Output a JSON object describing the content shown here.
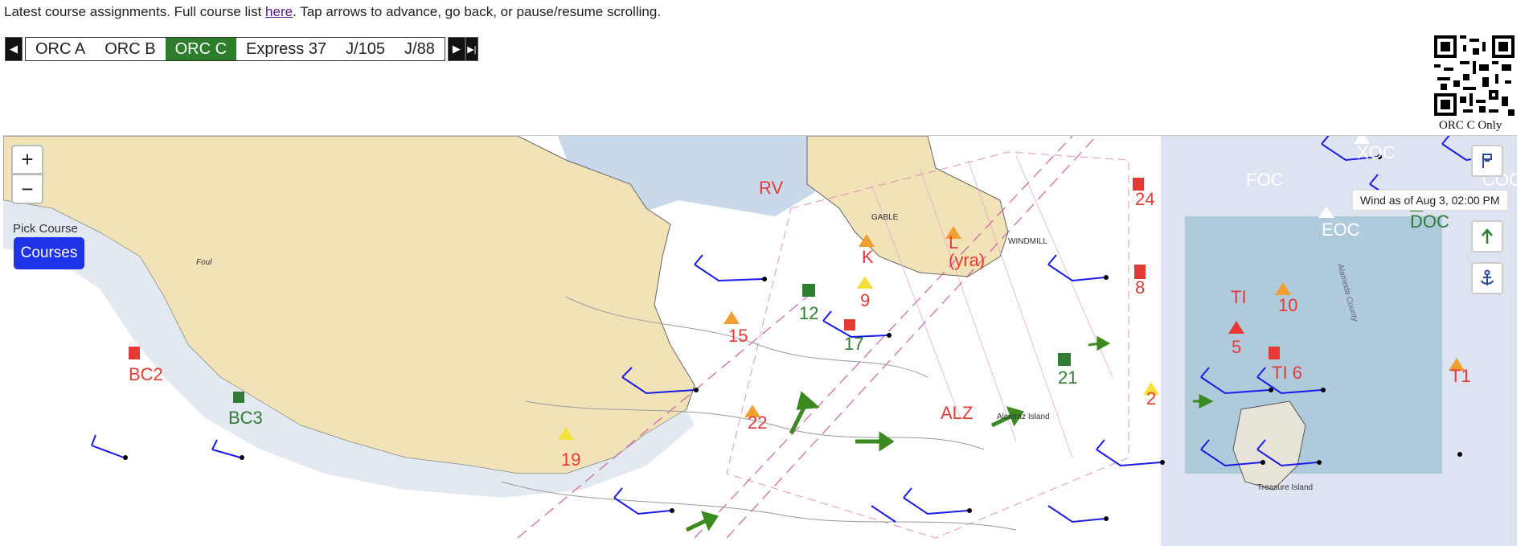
{
  "intro": {
    "prefix": "Latest course assignments. Full course list ",
    "link": "here",
    "suffix": ". Tap arrows to advance, go back, or pause/resume scrolling."
  },
  "classes": {
    "tabs": [
      {
        "label": "ORC A",
        "active": false
      },
      {
        "label": "ORC B",
        "active": false
      },
      {
        "label": "ORC C",
        "active": true
      },
      {
        "label": "Express 37",
        "active": false
      },
      {
        "label": "J/105",
        "active": false
      },
      {
        "label": "J/88",
        "active": false
      }
    ],
    "prev_icon": "triangle-left-icon",
    "next_icon": "triangle-right-icon",
    "pause_icon": "skip-end-icon"
  },
  "qr": {
    "caption": "ORC C Only"
  },
  "map": {
    "pick_label": "Pick Course",
    "courses_label": "Courses",
    "zoom_in": "+",
    "zoom_out": "−",
    "wind_time": "Wind as of Aug 3, 02:00 PM",
    "controls": [
      "flag-icon",
      "north-arrow-icon",
      "anchor-icon"
    ],
    "colors": {
      "land": "#f2e2b8",
      "water": "#ffffff",
      "shallow": "#c9d8ea",
      "overlay": "#a8c6d8",
      "red_mark": "#e53935",
      "green_mark": "#2e7d32",
      "wind": "#1a1ae6",
      "arrow": "#3a8a20"
    },
    "marks": [
      {
        "label": "BC2",
        "color": "red"
      },
      {
        "label": "BC3",
        "color": "green"
      },
      {
        "label": "RV",
        "color": "red"
      },
      {
        "label": "24",
        "color": "red"
      },
      {
        "label": "K",
        "color": "red"
      },
      {
        "label": "L",
        "color": "red"
      },
      {
        "label": "(yra)",
        "color": "red"
      },
      {
        "label": "9",
        "color": "red"
      },
      {
        "label": "12",
        "color": "green"
      },
      {
        "label": "15",
        "color": "red"
      },
      {
        "label": "17",
        "color": "green"
      },
      {
        "label": "8",
        "color": "red"
      },
      {
        "label": "TI",
        "color": "red"
      },
      {
        "label": "10",
        "color": "red"
      },
      {
        "label": "5",
        "color": "red"
      },
      {
        "label": "TI_6",
        "color": "red"
      },
      {
        "label": "T1",
        "color": "red"
      },
      {
        "label": "21",
        "color": "green"
      },
      {
        "label": "2",
        "color": "red"
      },
      {
        "label": "22",
        "color": "red"
      },
      {
        "label": "19",
        "color": "red"
      },
      {
        "label": "ALZ",
        "color": "red"
      },
      {
        "label": "DOC",
        "color": "green"
      },
      {
        "label": "EOC",
        "color": "white"
      },
      {
        "label": "FOC",
        "color": "white"
      },
      {
        "label": "XOC",
        "color": "white"
      },
      {
        "label": "COC",
        "color": "white"
      }
    ],
    "chart_text": [
      {
        "label": "GABLE"
      },
      {
        "label": "Wind as of"
      },
      {
        "label": "Treasure Island"
      },
      {
        "label": "Alcatraz Island"
      },
      {
        "label": "Foul"
      },
      {
        "label": "Alameda County"
      },
      {
        "label": "WINDMILL"
      }
    ]
  }
}
